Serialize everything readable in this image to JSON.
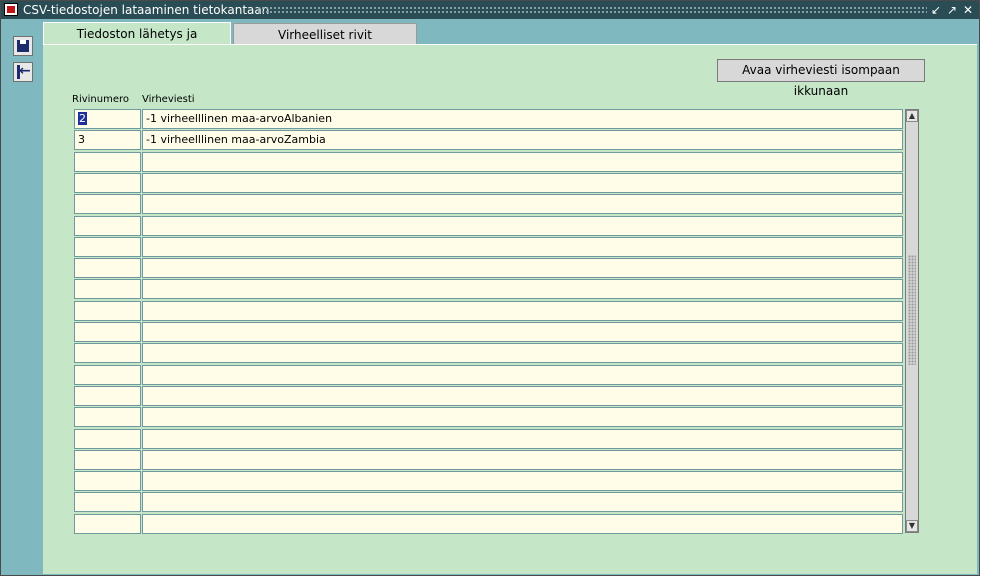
{
  "window": {
    "title": "CSV-tiedostojen lataaminen tietokantaan",
    "minimize_icon": "minimize-icon",
    "maximize_icon": "maximize-icon",
    "close_icon": "close-icon"
  },
  "toolbar": {
    "icons": [
      "save-icon",
      "exit-icon"
    ]
  },
  "tabs": [
    {
      "label": "Tiedoston lähetys ja lukeminen",
      "active": true
    },
    {
      "label": "Virheelliset rivit",
      "active": false
    }
  ],
  "main": {
    "open_button_label": "Avaa virheviesti isompaan ikkunaan",
    "columns": {
      "rownum": "Rivinumero",
      "message": "Virheviesti"
    },
    "rows": [
      {
        "rownum": "2",
        "message": "-1  virheelllinen maa-arvoAlbanien"
      },
      {
        "rownum": "3",
        "message": "-1  virheelllinen maa-arvoZambia"
      },
      {
        "rownum": "",
        "message": ""
      },
      {
        "rownum": "",
        "message": ""
      },
      {
        "rownum": "",
        "message": ""
      },
      {
        "rownum": "",
        "message": ""
      },
      {
        "rownum": "",
        "message": ""
      },
      {
        "rownum": "",
        "message": ""
      },
      {
        "rownum": "",
        "message": ""
      },
      {
        "rownum": "",
        "message": ""
      },
      {
        "rownum": "",
        "message": ""
      },
      {
        "rownum": "",
        "message": ""
      },
      {
        "rownum": "",
        "message": ""
      },
      {
        "rownum": "",
        "message": ""
      },
      {
        "rownum": "",
        "message": ""
      },
      {
        "rownum": "",
        "message": ""
      },
      {
        "rownum": "",
        "message": ""
      },
      {
        "rownum": "",
        "message": ""
      },
      {
        "rownum": "",
        "message": ""
      },
      {
        "rownum": "",
        "message": ""
      }
    ]
  }
}
